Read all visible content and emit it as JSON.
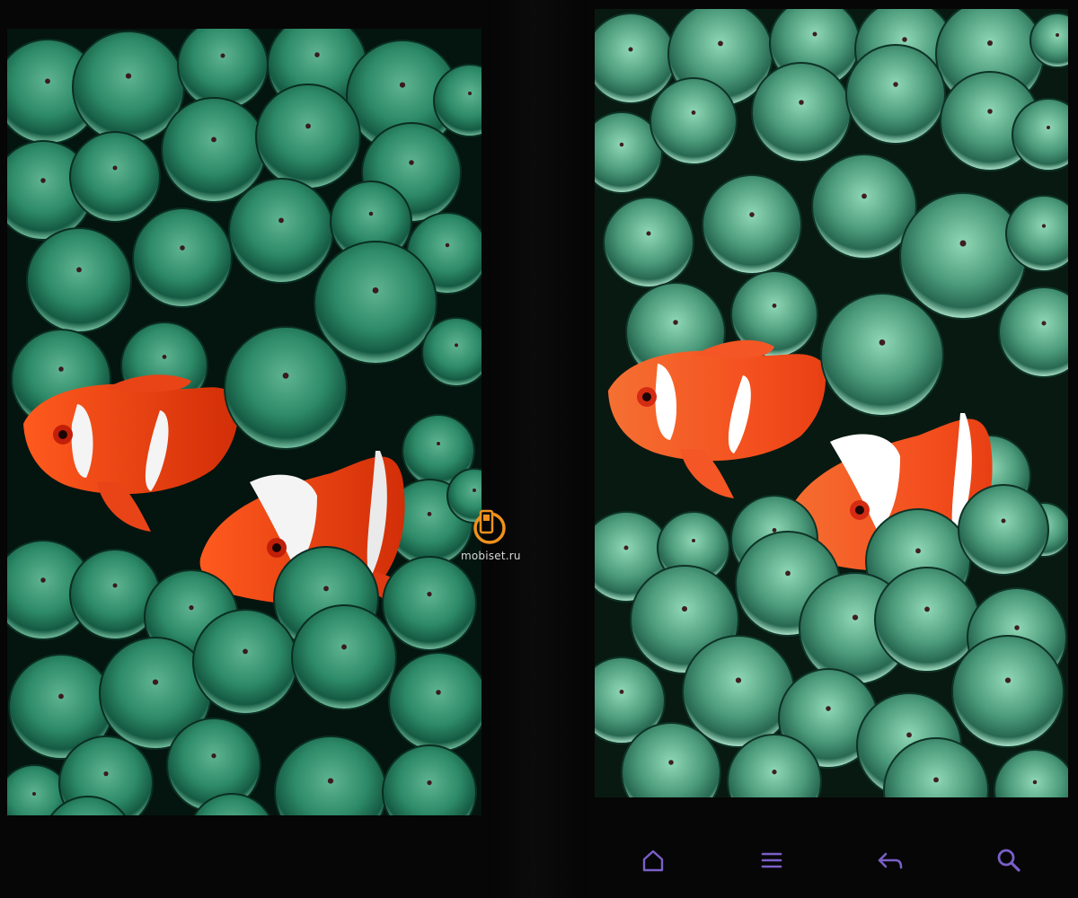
{
  "watermark": {
    "text": "mobiset.ru",
    "logo_color": "#f0921c"
  },
  "navigation_bar": {
    "icon_color": "#7a5fc8",
    "buttons": [
      {
        "name": "home-icon"
      },
      {
        "name": "menu-icon"
      },
      {
        "name": "back-icon"
      },
      {
        "name": "search-icon"
      }
    ]
  },
  "colors": {
    "background": "#060606",
    "anemone_green": "#2f8a6a",
    "clownfish_orange": "#e3400f",
    "stripe_white": "#f2f2f2"
  }
}
